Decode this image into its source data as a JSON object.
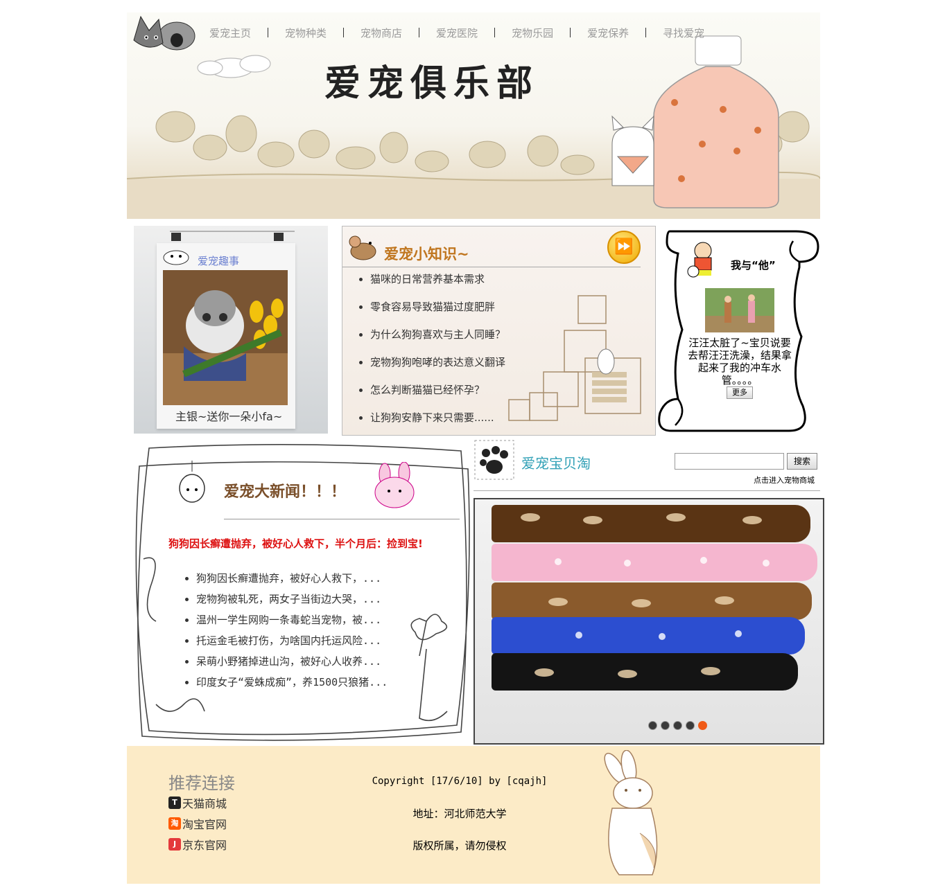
{
  "nav": {
    "items": [
      "爱宠主页",
      "宠物种类",
      "宠物商店",
      "爱宠医院",
      "宠物乐园",
      "爱宠保养",
      "寻找爱宠"
    ]
  },
  "header": {
    "title": "爱宠俱乐部"
  },
  "fun": {
    "title": "爱宠趣事",
    "caption": "主银~送你一朵小fa~"
  },
  "knowledge": {
    "title": "爱宠小知识~",
    "items": [
      "猫咪的日常营养基本需求",
      "零食容易导致猫猫过度肥胖",
      "为什么狗狗喜欢与主人同睡？",
      "宠物狗狗咆哮的表达意义翻译",
      "怎么判断猫猫已经怀孕？",
      "让狗狗安静下来只需要......"
    ]
  },
  "story": {
    "title": "我与“他”",
    "text": "汪汪太脏了~宝贝说要去帮汪汪洗澡，结果拿起来了我的冲车水管。。。。",
    "more_label": "更多"
  },
  "news": {
    "title": "爱宠大新闻！！！",
    "headline": "狗狗因长癣遭抛弃，被好心人救下，半个月后：捡到宝!",
    "items": [
      "狗狗因长癣遭抛弃，被好心人救下，...",
      "宠物狗被轧死，两女子当街边大哭，...",
      "温州一学生网购一条毒蛇当宠物，被...",
      "托运金毛被打伤，为啥国内托运风险...",
      "呆萌小野猪掉进山沟，被好心人收养...",
      "印度女子“爱蛛成痴”，养1500只狼猪..."
    ]
  },
  "shop": {
    "title": "爱宠宝贝淘",
    "search_button": "搜索",
    "search_placeholder": "",
    "enter_link": "点击进入宠物商城",
    "slider": {
      "slide_count": 5,
      "active_index": 4
    }
  },
  "footer": {
    "recommend_title": "推荐连接",
    "links": [
      {
        "label": "天猫商城",
        "icon": "tmall-icon"
      },
      {
        "label": "淘宝官网",
        "icon": "taobao-icon"
      },
      {
        "label": "京东官网",
        "icon": "jd-icon"
      }
    ],
    "copyright": "Copyright [17/6/10] by [cqajh]",
    "address": "地址：河北师范大学",
    "rights": "版权所属，请勿侵权"
  },
  "colors": {
    "knowledge_title": "#c0761f",
    "news_headline": "#dd1111",
    "shop_title": "#30a0b6",
    "footer_bg": "#fcebc7",
    "active_dot": "#f05a16"
  }
}
